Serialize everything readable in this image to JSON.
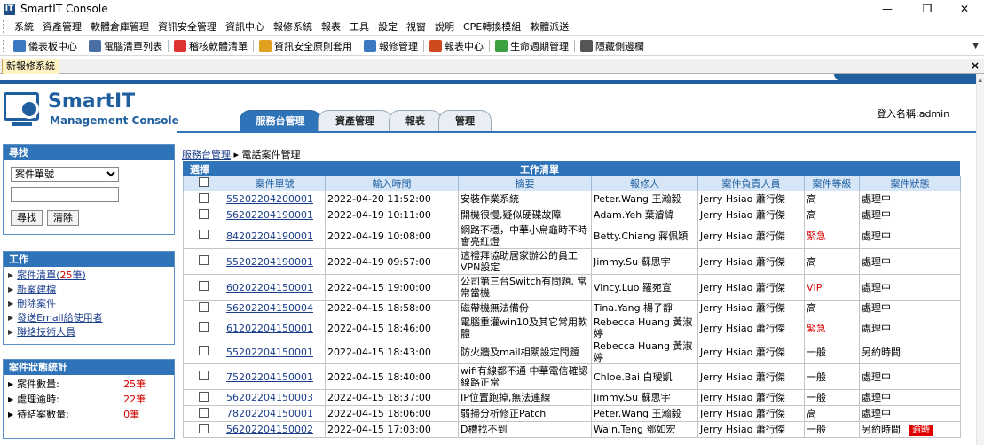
{
  "window": {
    "title": "SmartIT Console",
    "app_icon": "IT",
    "minimize": "—",
    "maximize": "❐",
    "close": "✕"
  },
  "menu": [
    "系統",
    "資產管理",
    "軟體倉庫管理",
    "資訊安全管理",
    "資訊中心",
    "報修系統",
    "報表",
    "工具",
    "設定",
    "視窗",
    "說明",
    "CPE轉換模組",
    "軟體派送"
  ],
  "toolbar": [
    {
      "label": "儀表板中心",
      "icon": "dashboard-icon",
      "color": "#3a78c2"
    },
    {
      "label": "電腦清單列表",
      "icon": "computer-list-icon",
      "color": "#4a6fa5"
    },
    {
      "label": "稽核軟體清單",
      "icon": "audit-software-icon",
      "color": "#d33"
    },
    {
      "label": "資訊安全原則套用",
      "icon": "security-policy-icon",
      "color": "#e0a020"
    },
    {
      "label": "報修管理",
      "icon": "repair-management-icon",
      "color": "#3a78c2"
    },
    {
      "label": "報表中心",
      "icon": "report-center-icon",
      "color": "#d04a20"
    },
    {
      "label": "生命週期管理",
      "icon": "lifecycle-icon",
      "color": "#3aa040"
    },
    {
      "label": "隱藏側邊欄",
      "icon": "hide-sidebar-icon",
      "color": "#555"
    }
  ],
  "doc_tab": {
    "label": "新報修系統",
    "close": "×"
  },
  "logo": {
    "main": "SmartIT",
    "sub": "Management Console"
  },
  "main_tabs": [
    "服務台管理",
    "資產管理",
    "報表",
    "管理"
  ],
  "login": "登入名稱:admin",
  "search": {
    "title": "尋找",
    "select_value": "案件單號",
    "input_value": "",
    "find_button": "尋找",
    "clear_button": "清除"
  },
  "work": {
    "title": "工作",
    "items": [
      {
        "label": "案件清單(",
        "count": "25",
        "suffix": "筆)"
      },
      {
        "label": "新案建檔"
      },
      {
        "label": "刪除案件"
      },
      {
        "label": "發送Email給使用者"
      },
      {
        "label": "聯絡技術人員"
      }
    ]
  },
  "stats": {
    "title": "案件狀態統計",
    "rows": [
      {
        "label": "案件數量:",
        "value": "25筆"
      },
      {
        "label": "處理逾時:",
        "value": "22筆"
      },
      {
        "label": "待結案數量:",
        "value": "0筆"
      }
    ]
  },
  "breadcrumb": {
    "link": "服務台管理",
    "sep": "▸",
    "current": "電話案件管理"
  },
  "table": {
    "select_header": "選擇",
    "list_header": "工作清單",
    "columns": [
      "案件單號",
      "輸入時間",
      "摘要",
      "報修人",
      "案件負責人員",
      "案件等級",
      "案件狀態"
    ],
    "rows": [
      {
        "id": "55202204200001",
        "time": "2022-04-20 11:52:00",
        "summary": "安裝作業系統",
        "reporter": "Peter.Wang 王瀚毅",
        "owner": "Jerry Hsiao 蕭行傑",
        "level": "高",
        "level_red": false,
        "status": "處理中",
        "overdue": ""
      },
      {
        "id": "56202204190001",
        "time": "2022-04-19 10:11:00",
        "summary": "開機很慢,疑似硬碟故障",
        "reporter": "Adam.Yeh 葉濬緯",
        "owner": "Jerry Hsiao 蕭行傑",
        "level": "高",
        "level_red": false,
        "status": "處理中",
        "overdue": ""
      },
      {
        "id": "84202204190001",
        "time": "2022-04-19 10:08:00",
        "summary": "網路不穩，中華小烏龜時不時會亮紅燈",
        "reporter": "Betty.Chiang 蔣佩穎",
        "owner": "Jerry Hsiao 蕭行傑",
        "level": "緊急",
        "level_red": true,
        "status": "處理中",
        "overdue": ""
      },
      {
        "id": "55202204190001",
        "time": "2022-04-19 09:57:00",
        "summary": "這禮拜協助居家辦公的員工VPN設定",
        "reporter": "Jimmy.Su 蘇思宇",
        "owner": "Jerry Hsiao 蕭行傑",
        "level": "高",
        "level_red": false,
        "status": "處理中",
        "overdue": ""
      },
      {
        "id": "60202204150001",
        "time": "2022-04-15 19:00:00",
        "summary": "公司第三台Switch有問題, 常常當機",
        "reporter": "Vincy.Luo 羅宛宣",
        "owner": "Jerry Hsiao 蕭行傑",
        "level": "VIP",
        "level_red": true,
        "status": "處理中",
        "overdue": ""
      },
      {
        "id": "56202204150004",
        "time": "2022-04-15 18:58:00",
        "summary": "磁帶機無法備份",
        "reporter": "Tina.Yang 楊子靜",
        "owner": "Jerry Hsiao 蕭行傑",
        "level": "高",
        "level_red": false,
        "status": "處理中",
        "overdue": ""
      },
      {
        "id": "61202204150001",
        "time": "2022-04-15 18:46:00",
        "summary": "電腦重灌win10及其它常用軟體",
        "reporter": "Rebecca Huang 黃淑婷",
        "owner": "Jerry Hsiao 蕭行傑",
        "level": "緊急",
        "level_red": true,
        "status": "處理中",
        "overdue": ""
      },
      {
        "id": "55202204150001",
        "time": "2022-04-15 18:43:00",
        "summary": "防火牆及mail相關設定問題",
        "reporter": "Rebecca Huang 黃淑婷",
        "owner": "Jerry Hsiao 蕭行傑",
        "level": "一般",
        "level_red": false,
        "status": "另約時間",
        "overdue": ""
      },
      {
        "id": "75202204150001",
        "time": "2022-04-15 18:40:00",
        "summary": "wifi有線都不通 中華電信確認線路正常",
        "reporter": "Chloe.Bai 白璦凱",
        "owner": "Jerry Hsiao 蕭行傑",
        "level": "一般",
        "level_red": false,
        "status": "處理中",
        "overdue": ""
      },
      {
        "id": "56202204150003",
        "time": "2022-04-15 18:37:00",
        "summary": "IP位置跑掉,無法連線",
        "reporter": "Jimmy.Su 蘇思宇",
        "owner": "Jerry Hsiao 蕭行傑",
        "level": "一般",
        "level_red": false,
        "status": "處理中",
        "overdue": ""
      },
      {
        "id": "78202204150001",
        "time": "2022-04-15 18:06:00",
        "summary": "弱掃分析修正Patch",
        "reporter": "Peter.Wang 王瀚毅",
        "owner": "Jerry Hsiao 蕭行傑",
        "level": "高",
        "level_red": false,
        "status": "處理中",
        "overdue": ""
      },
      {
        "id": "56202204150002",
        "time": "2022-04-15 17:03:00",
        "summary": "D槽找不到",
        "reporter": "Wain.Teng 鄧如宏",
        "owner": "Jerry Hsiao 蕭行傑",
        "level": "一般",
        "level_red": false,
        "status": "另約時間",
        "overdue": "逾時"
      }
    ]
  }
}
